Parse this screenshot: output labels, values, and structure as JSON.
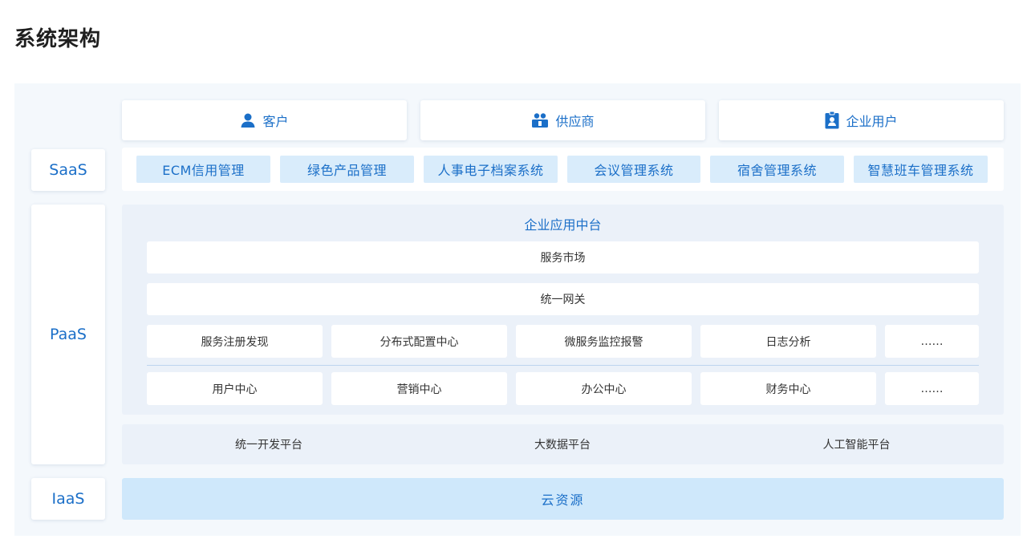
{
  "title": "系统架构",
  "colors": {
    "accent": "#1b6fc8",
    "panel": "#f4f8fc",
    "chip": "#d9ecfb",
    "paas_bg": "#ebf1f9",
    "iaas_bg": "#cfe8fb"
  },
  "users": [
    {
      "label": "客户",
      "icon": "user-icon"
    },
    {
      "label": "供应商",
      "icon": "supplier-icon"
    },
    {
      "label": "企业用户",
      "icon": "badge-icon"
    }
  ],
  "layers": {
    "saas": "SaaS",
    "paas": "PaaS",
    "iaas": "IaaS"
  },
  "saas_apps": [
    "ECM信用管理",
    "绿色产品管理",
    "人事电子档案系统",
    "会议管理系统",
    "宿舍管理系统",
    "智慧班车管理系统"
  ],
  "paas": {
    "title": "企业应用中台",
    "bars": [
      "服务市场",
      "统一网关"
    ],
    "services": [
      "服务注册发现",
      "分布式配置中心",
      "微服务监控报警",
      "日志分析",
      "……"
    ],
    "centers": [
      "用户中心",
      "营销中心",
      "办公中心",
      "财务中心",
      "……"
    ]
  },
  "platforms": [
    "统一开发平台",
    "大数据平台",
    "人工智能平台"
  ],
  "iaas": "云资源"
}
